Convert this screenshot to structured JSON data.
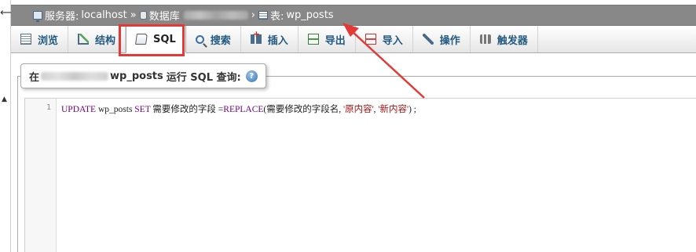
{
  "breadcrumb": {
    "server_label": "服务器:",
    "server_name": "localhost",
    "db_label": "数据库",
    "table_label": "表:",
    "table_name": "wp_posts",
    "separator": "»",
    "separator2": "›"
  },
  "tabs": [
    {
      "label": "浏览",
      "icon": "browse-icon"
    },
    {
      "label": "结构",
      "icon": "structure-icon"
    },
    {
      "label": "SQL",
      "icon": "sql-icon",
      "active": true
    },
    {
      "label": "搜索",
      "icon": "search-icon"
    },
    {
      "label": "插入",
      "icon": "insert-icon"
    },
    {
      "label": "导出",
      "icon": "export-icon"
    },
    {
      "label": "导入",
      "icon": "import-icon"
    },
    {
      "label": "操作",
      "icon": "wrench-icon"
    },
    {
      "label": "触发器",
      "icon": "triggers-icon"
    }
  ],
  "query_box": {
    "prefix": "在",
    "table_name": "wp_posts",
    "suffix": "运行 SQL 查询:",
    "help": "?"
  },
  "editor": {
    "line_number": "1",
    "kw_update": "UPDATE",
    "table": " wp_posts ",
    "kw_set": "SET",
    "field": " 需要修改的字段 =",
    "fn_replace": "REPLACE",
    "args_open": "(需要修改的字段名, ",
    "str1": "'原内容'",
    "comma": ", ",
    "str2": "'新内容'",
    "tail": ") ;"
  },
  "colors": {
    "highlight": "#e53935",
    "tab_text": "#235a81",
    "breadcrumb_bg": "#888888"
  }
}
